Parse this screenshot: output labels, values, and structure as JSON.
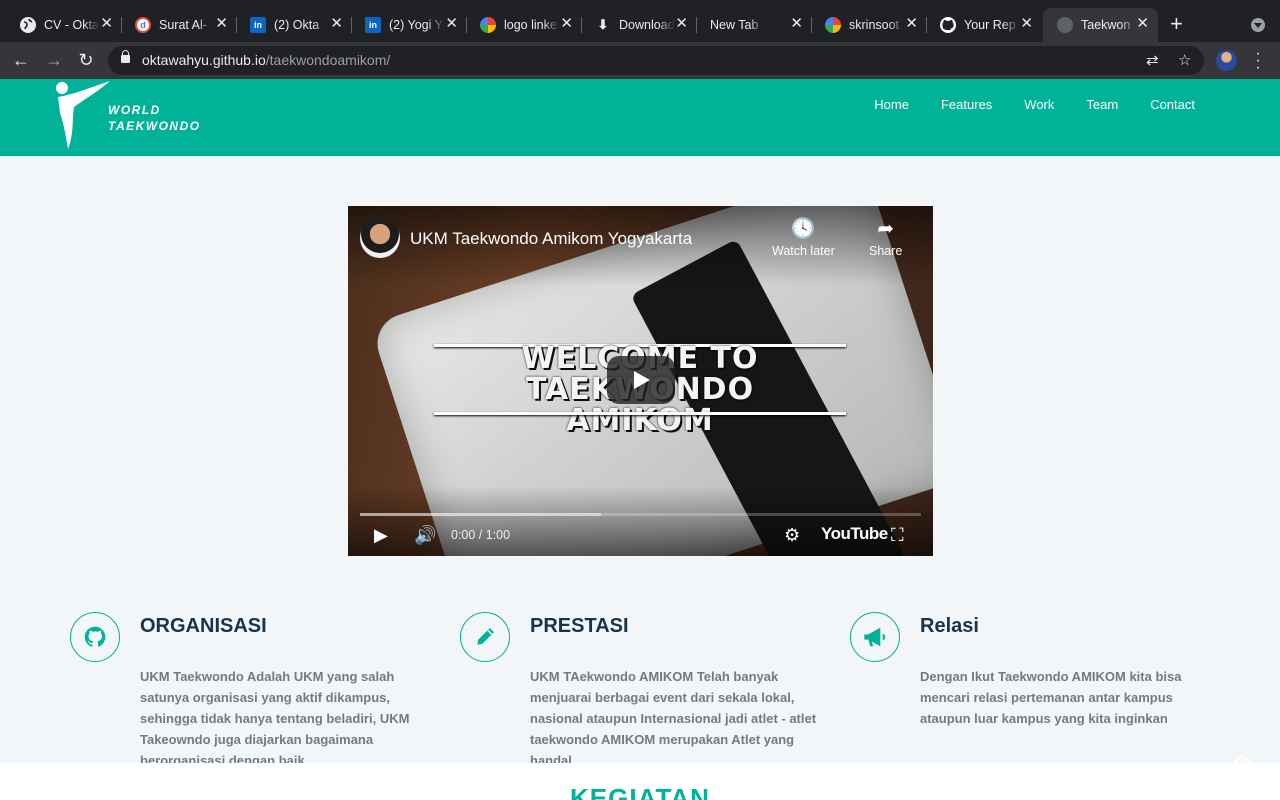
{
  "browser": {
    "tabs": [
      {
        "title": "CV - Okta",
        "icon": "globe-icon",
        "icon_color": "#9aa0a6"
      },
      {
        "title": "Surat Al-",
        "icon": "d-icon",
        "icon_color": "#5b6ee1"
      },
      {
        "title": "(2) Okta",
        "icon": "linkedin-icon",
        "icon_color": "#0a66c2"
      },
      {
        "title": "(2) Yogi Y",
        "icon": "linkedin-icon",
        "icon_color": "#0a66c2"
      },
      {
        "title": "logo linke",
        "icon": "google-icon",
        "icon_color": "#ffffff"
      },
      {
        "title": "Download",
        "icon": "download-icon",
        "icon_color": "#202124"
      },
      {
        "title": "New Tab",
        "icon": "none",
        "icon_color": "#202124"
      },
      {
        "title": "skrinsoot",
        "icon": "google-icon",
        "icon_color": "#ffffff"
      },
      {
        "title": "Your Rep",
        "icon": "github-icon",
        "icon_color": "#ffffff"
      },
      {
        "title": "Taekwon",
        "icon": "globe-icon",
        "icon_color": "#5f6368",
        "active": true
      }
    ],
    "url_host": "oktawahyu.github.io",
    "url_path": "/taekwondoamikom/"
  },
  "site": {
    "logo_line1": "WORLD",
    "logo_line2": "TAEKWONDO",
    "nav": [
      "Home",
      "Features",
      "Work",
      "Team",
      "Contact"
    ],
    "brand_color": "#00b398"
  },
  "video": {
    "title": "UKM Taekwondo Amikom Yogyakarta",
    "watch_later": "Watch later",
    "share": "Share",
    "overlay_line1": "WELCOME TO TAEKWONDO",
    "overlay_line2": "AMIKOM",
    "time": "0:00 / 1:00",
    "provider": "YouTube"
  },
  "features": [
    {
      "icon": "github-icon",
      "title": "ORGANISASI",
      "desc": "UKM Taekwondo Adalah UKM yang salah satunya organisasi yang aktif dikampus, sehingga tidak hanya tentang beladiri, UKM Takeowndo juga diajarkan bagaimana berorganisasi dengan baik"
    },
    {
      "icon": "pencil-icon",
      "title": "PRESTASI",
      "desc": "UKM TAekwondo AMIKOM Telah banyak menjuarai berbagai event dari sekala lokal, nasional ataupun Internasional jadi atlet - atlet taekwondo AMIKOM merupakan Atlet yang handal"
    },
    {
      "icon": "megaphone-icon",
      "title": "Relasi",
      "desc": "Dengan Ikut Taekwondo AMIKOM kita bisa mencari relasi pertemanan antar kampus ataupun luar kampus yang kita inginkan"
    }
  ],
  "section_heading": "KEGIATAN"
}
